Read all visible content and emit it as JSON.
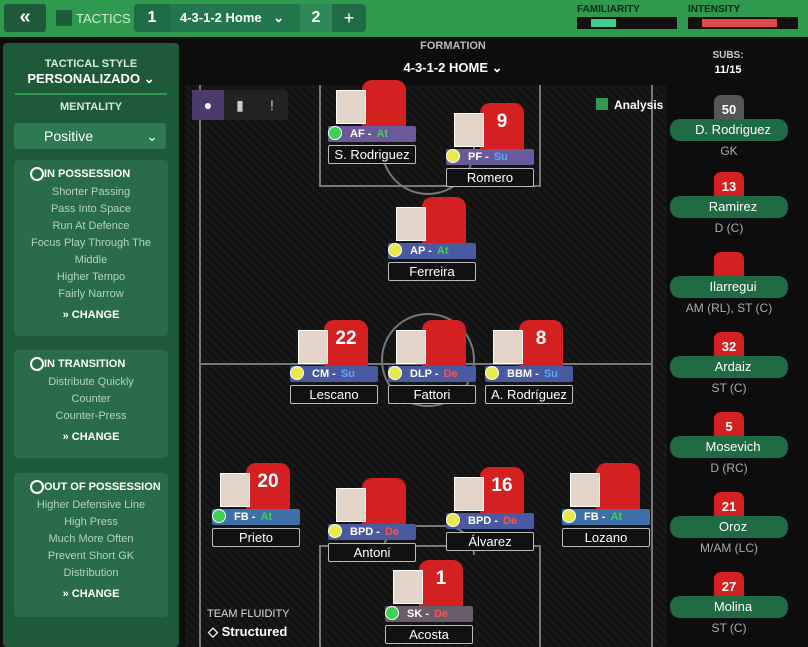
{
  "topbar": {
    "back_icon": "«",
    "tactics_label": "TACTICS",
    "slot1": "1",
    "formation_name": "4-3-1-2 Home",
    "slot2": "2",
    "add": "+",
    "familiarity_label": "FAMILIARITY",
    "intensity_label": "INTENSITY",
    "familiarity_level": 0.3,
    "intensity_level": 0.8
  },
  "left": {
    "style_label": "TACTICAL STYLE",
    "style_value": "PERSONALIZADO",
    "mentality_label": "MENTALITY",
    "mentality_value": "Positive",
    "possession": {
      "title": "IN POSSESSION",
      "items": [
        "Shorter Passing",
        "Pass Into Space",
        "Run At Defence",
        "Focus Play Through The",
        "Middle",
        "Higher Tempo",
        "Fairly Narrow"
      ],
      "change": "CHANGE"
    },
    "transition": {
      "title": "IN TRANSITION",
      "items": [
        "Distribute Quickly",
        "Counter",
        "Counter-Press"
      ],
      "change": "CHANGE"
    },
    "outpos": {
      "title": "OUT OF POSSESSION",
      "items": [
        "Higher Defensive Line",
        "High Press",
        "Much More Often",
        "Prevent Short GK",
        "Distribution"
      ],
      "change": "CHANGE"
    }
  },
  "formation": {
    "label": "FORMATION",
    "value": "4-3-1-2 HOME"
  },
  "analysis": "Analysis",
  "fluidity": {
    "label": "TEAM FLUIDITY",
    "value": "Structured"
  },
  "players": [
    {
      "num": "",
      "role": "AF",
      "duty": "At",
      "duty_color": "#3fd14f",
      "name": "S. Rodriguez",
      "role_color": "#6a5a9c",
      "dot": "#3fd14f"
    },
    {
      "num": "9",
      "role": "PF",
      "duty": "Su",
      "duty_color": "#5aa5ff",
      "name": "Romero",
      "role_color": "#6a5a9c",
      "dot": "#e8e84a"
    },
    {
      "num": "",
      "role": "AP",
      "duty": "At",
      "duty_color": "#3fd14f",
      "name": "Ferreira",
      "role_color": "#4a5aa0",
      "dot": "#e8e84a"
    },
    {
      "num": "22",
      "role": "CM",
      "duty": "Su",
      "duty_color": "#5aa5ff",
      "name": "Lescano",
      "role_color": "#4a5aa0",
      "dot": "#e8e84a"
    },
    {
      "num": "",
      "role": "DLP",
      "duty": "De",
      "duty_color": "#ff5050",
      "name": "Fattori",
      "role_color": "#4a5aa0",
      "dot": "#e8e84a"
    },
    {
      "num": "8",
      "role": "BBM",
      "duty": "Su",
      "duty_color": "#5aa5ff",
      "name": "A. Rodríguez",
      "role_color": "#4a5aa0",
      "dot": "#e8e84a"
    },
    {
      "num": "20",
      "role": "FB",
      "duty": "At",
      "duty_color": "#3fd14f",
      "name": "Prieto",
      "role_color": "#3d6fa8",
      "dot": "#3fd14f"
    },
    {
      "num": "",
      "role": "BPD",
      "duty": "De",
      "duty_color": "#ff5050",
      "name": "Antoni",
      "role_color": "#4a5aa0",
      "dot": "#e8e84a"
    },
    {
      "num": "16",
      "role": "BPD",
      "duty": "De",
      "duty_color": "#ff5050",
      "name": "Álvarez",
      "role_color": "#4a5aa0",
      "dot": "#e8e84a"
    },
    {
      "num": "",
      "role": "FB",
      "duty": "At",
      "duty_color": "#3fd14f",
      "name": "Lozano",
      "role_color": "#3d6fa8",
      "dot": "#e8e84a"
    },
    {
      "num": "1",
      "role": "SK",
      "duty": "De",
      "duty_color": "#ff5050",
      "name": "Acosta",
      "role_color": "#6a5a6a",
      "dot": "#3fd14f"
    }
  ],
  "subs": {
    "label": "SUBS:",
    "count": "11/15",
    "list": [
      {
        "num": "50",
        "name": "D. Rodriguez",
        "pos": "GK"
      },
      {
        "num": "13",
        "name": "Ramirez",
        "pos": "D (C)"
      },
      {
        "num": "",
        "name": "Ilarregui",
        "pos": "AM (RL), ST (C)"
      },
      {
        "num": "32",
        "name": "Ardaiz",
        "pos": "ST (C)"
      },
      {
        "num": "5",
        "name": "Mosevich",
        "pos": "D (RC)"
      },
      {
        "num": "21",
        "name": "Oroz",
        "pos": "M/AM (LC)"
      },
      {
        "num": "27",
        "name": "Molina",
        "pos": "ST (C)"
      }
    ]
  }
}
